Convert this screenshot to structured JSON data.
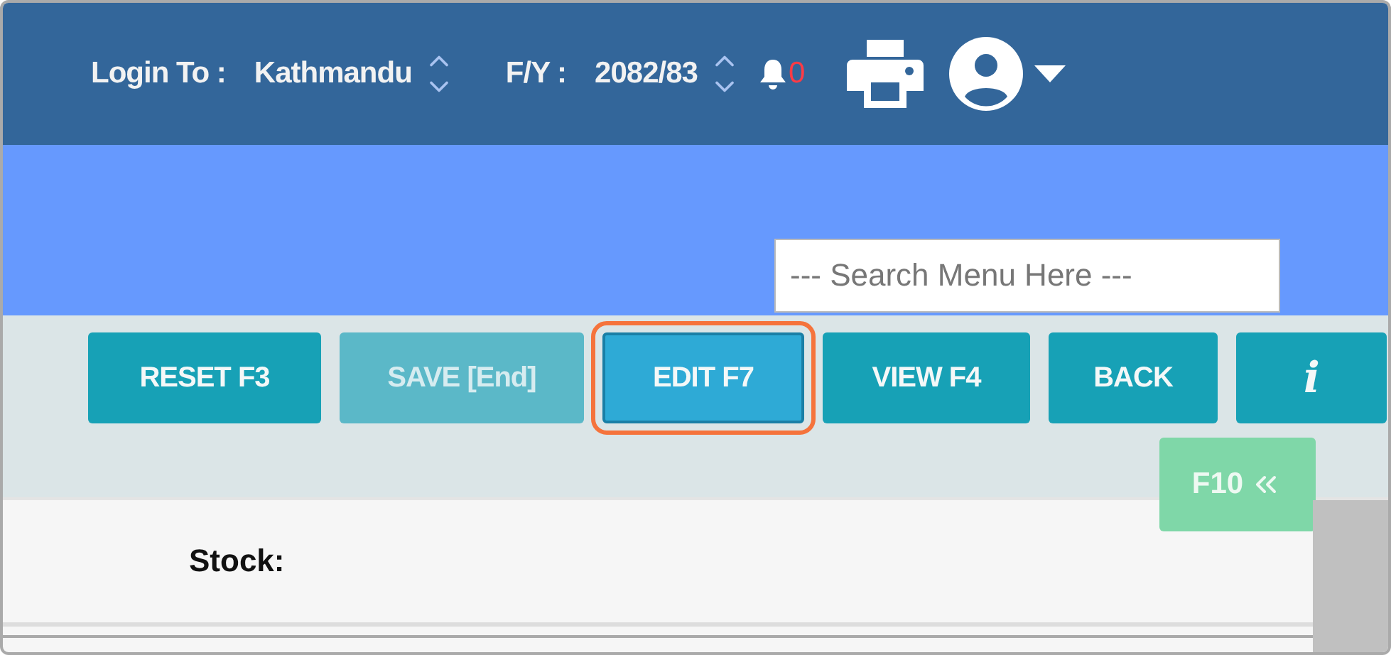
{
  "header": {
    "login_label": "Login To :",
    "login_value": "Kathmandu",
    "fy_label": "F/Y :",
    "fy_value": "2082/83",
    "notification_count": "0"
  },
  "search": {
    "placeholder": "--- Search Menu Here ---"
  },
  "toolbar": {
    "buttons": [
      {
        "label": "RESET F3",
        "disabled": false,
        "selected": false
      },
      {
        "label": "SAVE [End]",
        "disabled": true,
        "selected": false
      },
      {
        "label": "EDIT F7",
        "disabled": false,
        "selected": true
      },
      {
        "label": "VIEW F4",
        "disabled": false,
        "selected": false
      },
      {
        "label": "BACK",
        "disabled": false,
        "selected": false
      },
      {
        "label": "i",
        "disabled": false,
        "selected": false
      }
    ]
  },
  "side_toggle": {
    "label": "F10"
  },
  "form": {
    "stock_label": "Stock:"
  }
}
